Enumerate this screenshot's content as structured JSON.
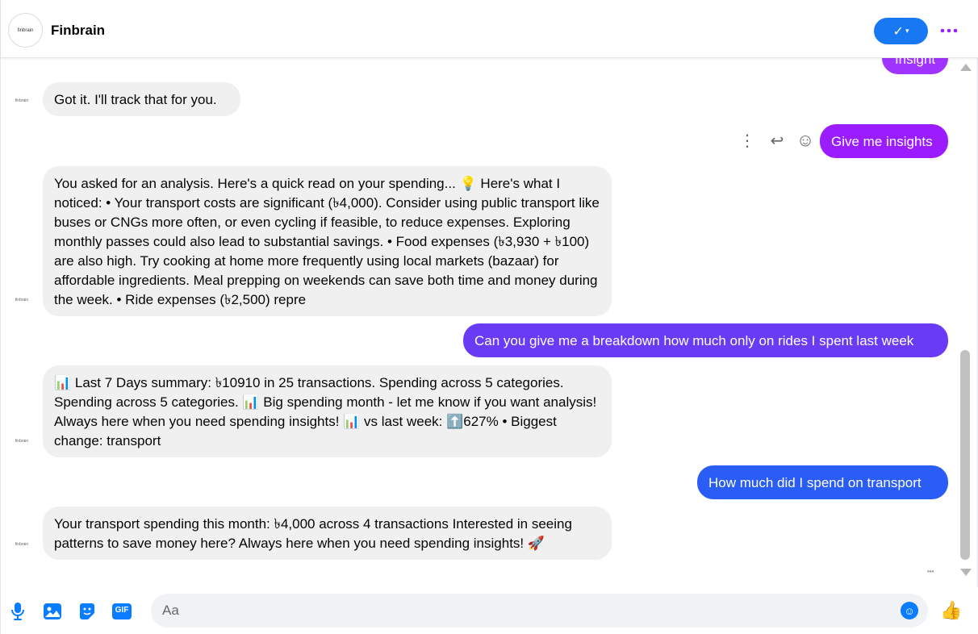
{
  "header": {
    "title": "Finbrain",
    "avatar_text": "finbrain",
    "seen_icon": "✓",
    "seen_chevron": "▾",
    "more_icon": "•••"
  },
  "messages": [
    {
      "id": "m0",
      "side": "out",
      "text": "Insight",
      "color": "#a033ff"
    },
    {
      "id": "m1",
      "side": "in",
      "text": "Got it. I'll track that for you."
    },
    {
      "id": "m2",
      "side": "out",
      "text": "Give me insights",
      "color": "#9b1cff"
    },
    {
      "id": "m3",
      "side": "in",
      "text": "You asked for an analysis. Here's a quick read on your spending... 💡 Here's what I noticed: • Your transport costs are significant (৳4,000). Consider using public transport like buses or CNGs more often, or even cycling if feasible, to reduce expenses. Exploring monthly passes could also lead to substantial savings. • Food expenses (৳3,930 + ৳100) are also high. Try cooking at home more frequently using local markets (bazaar) for affordable ingredients. Meal prepping on weekends can save both time and money during the week. • Ride expenses (৳2,500) repre"
    },
    {
      "id": "m4",
      "side": "out",
      "text": "Can you give me a breakdown how much only on rides I spent last week",
      "color": "#6a3bf5"
    },
    {
      "id": "m5",
      "side": "in",
      "text": "📊 Last 7 Days summary: ৳10910 in 25 transactions. Spending across 5 categories. Spending across 5 categories. 📊 Big spending month - let me know if you want analysis! Always here when you need spending insights! 📊 vs last week: ⬆️627% • Biggest change: transport"
    },
    {
      "id": "m6",
      "side": "out",
      "text": "How much did I spend on transport",
      "color": "#2a5cf6"
    },
    {
      "id": "m7",
      "side": "in",
      "text": "Your transport spending this month: ৳4,000 across 4 transactions Interested in seeing patterns to save money here? Always here when you need spending insights! 🚀"
    }
  ],
  "bot_avatar_text": "finbrain",
  "message_actions": {
    "more_icon": "⋮",
    "reply_icon": "↩",
    "react_icon": "☺"
  },
  "typing_indicator": "•••",
  "composer": {
    "placeholder": "Aa",
    "value": "",
    "icons": [
      "microphone-icon",
      "image-icon",
      "sticker-icon",
      "gif-icon",
      "emoji-icon",
      "thumbs-up-icon"
    ],
    "gif_label": "GIF",
    "like_glyph": "👍",
    "emoji_glyph": "☺"
  },
  "colors": {
    "accent": "#0a7cff",
    "seen_button": "#1877f2",
    "incoming_bubble": "#f0f0f0"
  }
}
